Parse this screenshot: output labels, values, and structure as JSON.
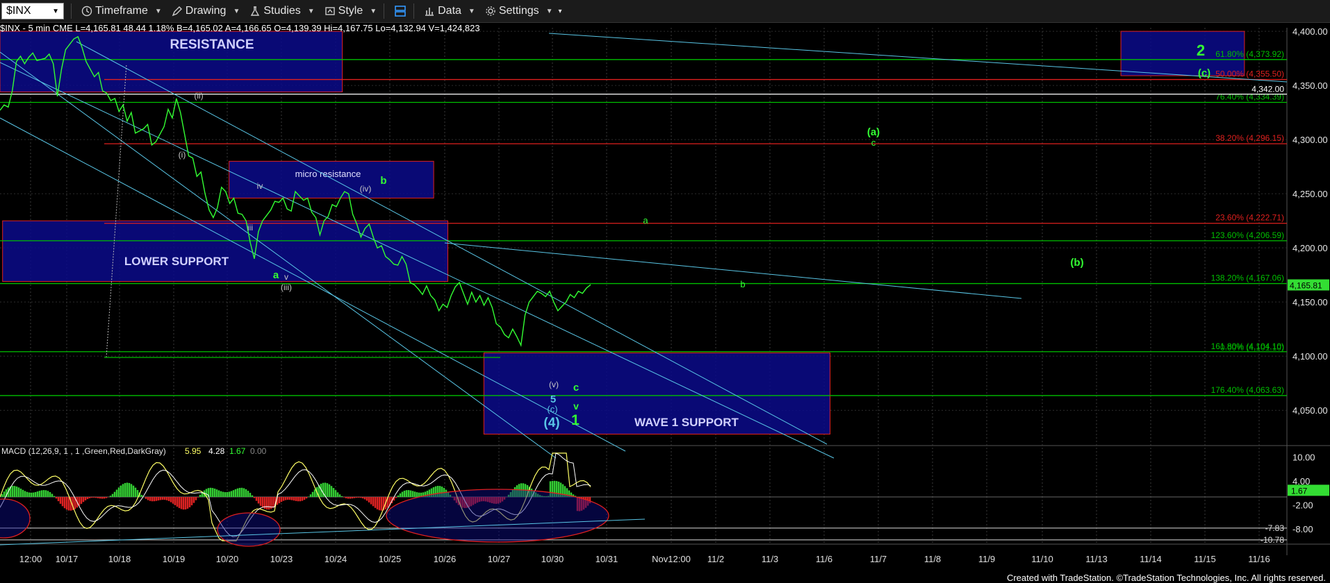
{
  "toolbar": {
    "symbol": "$INX",
    "timeframe": "Timeframe",
    "drawing": "Drawing",
    "studies": "Studies",
    "style": "Style",
    "data": "Data",
    "settings": "Settings"
  },
  "infobar": "$INX - 5 min  CME    L=4,165.81  48.44  1.18%  B=4,165.02  A=4,166.65  O=4,139.39  Hi=4,167.75  Lo=4,132.94  V=1,424,823",
  "footer": "Created with TradeStation. ©TradeStation Technologies, Inc. All rights reserved.",
  "chart_data": [
    {
      "type": "line",
      "panel": "price",
      "y_axis_ticks": [
        4400,
        4350,
        4300,
        4250,
        4200,
        4150,
        4100,
        4050
      ],
      "y_axis_labels": [
        "4,400.00",
        "4,350.00",
        "4,300.00",
        "4,250.00",
        "4,200.00",
        "4,150.00",
        "4,100.00",
        "4,050.00"
      ],
      "ylim": [
        4020,
        4402
      ],
      "x_labels": [
        "12:00",
        "10/17",
        "10/18",
        "10/19",
        "10/20",
        "10/23",
        "10/24",
        "10/25",
        "10/26",
        "10/27",
        "10/30",
        "10/31",
        "Nov12:00",
        "11/2",
        "11/3",
        "11/6",
        "11/7",
        "11/8",
        "11/9",
        "11/10",
        "11/13",
        "11/14",
        "11/15",
        "11/16"
      ],
      "last_price": {
        "value": 4165.81,
        "label": "4,165.81"
      },
      "price_series": [
        4327,
        4332,
        4330,
        4345,
        4372,
        4377,
        4370,
        4376,
        4380,
        4373,
        4374,
        4375,
        4379,
        4370,
        4340,
        4365,
        4383,
        4388,
        4393,
        4395,
        4385,
        4372,
        4365,
        4358,
        4362,
        4345,
        4343,
        4336,
        4338,
        4326,
        4332,
        4317,
        4325,
        4306,
        4308,
        4310,
        4314,
        4295,
        4298,
        4305,
        4312,
        4328,
        4320,
        4338,
        4325,
        4305,
        4285,
        4283,
        4266,
        4270,
        4250,
        4235,
        4228,
        4237,
        4256,
        4252,
        4241,
        4246,
        4232,
        4231,
        4225,
        4205,
        4190,
        4215,
        4225,
        4230,
        4235,
        4243,
        4242,
        4246,
        4236,
        4234,
        4252,
        4248,
        4244,
        4246,
        4233,
        4228,
        4212,
        4225,
        4229,
        4240,
        4238,
        4246,
        4252,
        4250,
        4231,
        4222,
        4210,
        4218,
        4222,
        4210,
        4200,
        4202,
        4192,
        4189,
        4185,
        4184,
        4192,
        4185,
        4168,
        4166,
        4162,
        4157,
        4165,
        4156,
        4152,
        4142,
        4148,
        4145,
        4156,
        4164,
        4168,
        4158,
        4148,
        4159,
        4150,
        4156,
        4147,
        4154,
        4145,
        4130,
        4127,
        4120,
        4117,
        4125,
        4118,
        4110,
        4138,
        4150,
        4155,
        4160,
        4158,
        4155,
        4160,
        4150,
        4142,
        4146,
        4150,
        4157,
        4154,
        4160,
        4158,
        4163,
        4166
      ],
      "zones": [
        {
          "label": "RESISTANCE",
          "top": 4400,
          "bottom": 4344,
          "x0": 0,
          "x1": 0.266
        },
        {
          "label": "micro resistance",
          "top": 4280,
          "bottom": 4246,
          "x0": 0.178,
          "x1": 0.337
        },
        {
          "label": "LOWER SUPPORT",
          "top": 4225,
          "bottom": 4169,
          "x0": 0.002,
          "x1": 0.348
        },
        {
          "label": "WAVE 1 SUPPORT",
          "top": 4103,
          "bottom": 4028,
          "x0": 0.376,
          "x1": 0.645
        },
        {
          "label": "",
          "top": 4400,
          "bottom": 4359,
          "x0": 0.871,
          "x1": 0.967
        }
      ],
      "fib_levels": [
        {
          "label": "61.80% (4,373.92)",
          "value": 4373.92,
          "color": "#00c000"
        },
        {
          "label": "50.00% (4,355.50)",
          "value": 4355.5,
          "color": "#e0201e"
        },
        {
          "label": "76.40% (4,334.39)",
          "value": 4334.39,
          "color": "#00c000"
        },
        {
          "label": "38.20% (4,296.15)",
          "value": 4296.15,
          "color": "#e0201e"
        },
        {
          "label": "23.60% (4,222.71)",
          "value": 4222.71,
          "color": "#e0201e"
        },
        {
          "label": "123.60% (4,206.59)",
          "value": 4206.59,
          "color": "#00c000"
        },
        {
          "label": "138.20% (4,167.06)",
          "value": 4167.06,
          "color": "#00c000"
        },
        {
          "label": "161.80% (4,104.10)",
          "value": 4104.1,
          "color": "#00c000"
        },
        {
          "label": "176.40% (4,063.63)",
          "value": 4063.63,
          "color": "#00c000"
        }
      ],
      "overlap_label": "0.00% (4,101.10)",
      "ref_line": {
        "value": 4342,
        "label": "4,342.00"
      },
      "wave_labels": [
        "(ii)",
        "(i)",
        "iv",
        "iii",
        "a",
        "v",
        "(iii)",
        "(iv)",
        "b",
        "(v)",
        "5",
        "(c)",
        "c",
        "v",
        "(4)",
        "1",
        "a",
        "(a)",
        "c",
        "b",
        "(b)",
        "2",
        "(c)"
      ]
    },
    {
      "type": "line",
      "panel": "macd",
      "title": "MACD (12,26,9, 1 , 1 ,Green,Red,DarkGray)",
      "values_text": [
        "5.95",
        "4.28",
        "1.67",
        "0.00"
      ],
      "values": [
        5.95,
        4.28,
        1.67,
        0.0
      ],
      "y_axis_labels": [
        "10.00",
        "4.00",
        "-2.00",
        "-8.00"
      ],
      "y_axis_ticks": [
        10,
        4,
        -2,
        -8
      ],
      "ylim": [
        -11.5,
        11.5
      ],
      "ref_labels": [
        "-7.83",
        "-10.78"
      ],
      "ref_values": [
        -7.83,
        -10.78
      ],
      "current": {
        "value": 1.67,
        "label": "1.67"
      },
      "legend": [
        "Green",
        "Red",
        "DarkGray"
      ]
    }
  ]
}
